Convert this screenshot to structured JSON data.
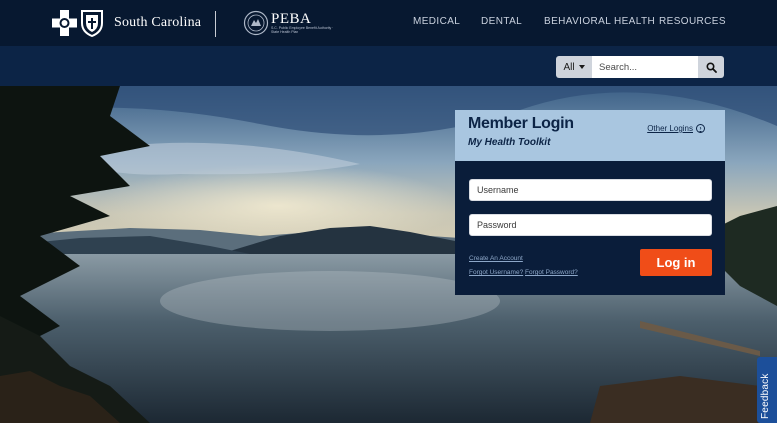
{
  "header": {
    "brand_name": "South Carolina",
    "peba_title": "PEBA",
    "peba_subtitle": "S.C. Public Employee Benefit Authority · State Health Plan",
    "nav": [
      {
        "label": "MEDICAL"
      },
      {
        "label": "DENTAL"
      },
      {
        "label": "BEHAVIORAL HEALTH"
      },
      {
        "label": "RESOURCES"
      }
    ]
  },
  "search": {
    "scope": "All",
    "placeholder": "Search...",
    "button_icon": "search-icon"
  },
  "login": {
    "title": "Member Login",
    "subtitle": "My Health Toolkit",
    "other_logins": "Other Logins",
    "username_placeholder": "Username",
    "password_placeholder": "Password",
    "create_account": "Create An Account",
    "forgot_username": "Forgot Username?",
    "forgot_password": "Forgot Password?",
    "submit": "Log in"
  },
  "feedback": {
    "label": "Feedback"
  },
  "colors": {
    "nav_background": "#071830",
    "login_header": "#a9c6e0",
    "login_button": "#f04d18",
    "feedback_tab": "#1c4f9a"
  }
}
